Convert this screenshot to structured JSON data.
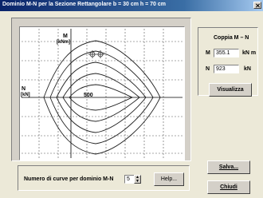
{
  "window": {
    "title": "Dominio M-N per la Sezione Rettangolare  b = 30 cm   h = 70 cm"
  },
  "plot": {
    "y_axis_label": "M",
    "y_axis_unit": "[kNm]",
    "x_axis_label": "N",
    "x_axis_unit": "[kN]",
    "x_tick_label": "500"
  },
  "coppia": {
    "title": "Coppia M – N",
    "m_label": "M",
    "m_value": "355.1",
    "m_unit": "kN m",
    "n_label": "N",
    "n_value": "923",
    "n_unit": "kN",
    "visualizza_label": "Visualizza"
  },
  "curves": {
    "label": "Numero di curve per dominio M-N",
    "value": "5",
    "help_label": "Help..."
  },
  "actions": {
    "salva_label": "Salva...",
    "chiudi_label": "Chiudi"
  }
}
